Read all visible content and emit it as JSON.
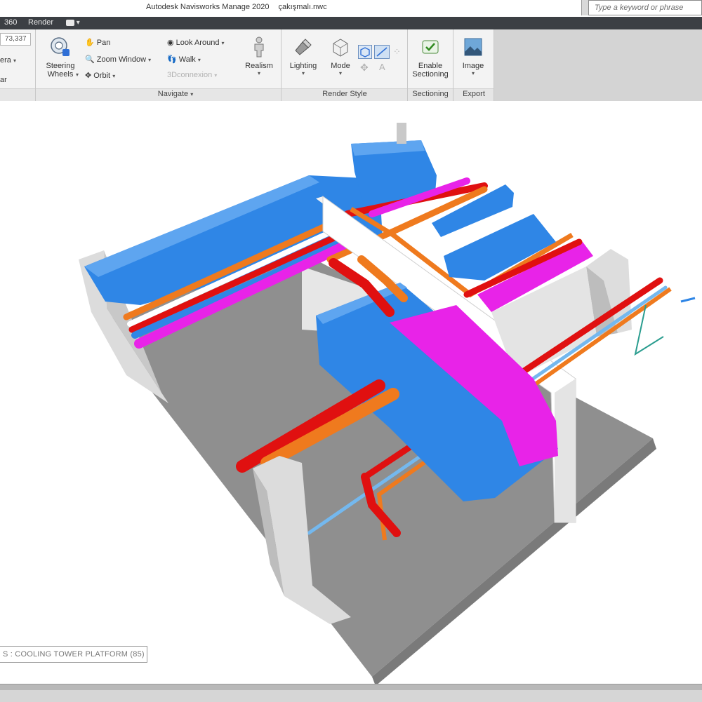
{
  "window": {
    "app_title": "Autodesk Navisworks Manage 2020",
    "file_name": "çakışmalı.nwc"
  },
  "search": {
    "placeholder": "Type a keyword or phrase"
  },
  "tabs": [
    {
      "label": "360"
    },
    {
      "label": "Render"
    }
  ],
  "ribbon": {
    "coordinate_value": "73,337",
    "left_partial_labels": [
      "era",
      "ar"
    ],
    "navigate": {
      "steering_wheels_line1": "Steering",
      "steering_wheels_line2": "Wheels",
      "pan": "Pan",
      "zoom_window": "Zoom Window",
      "orbit": "Orbit",
      "look_around": "Look Around",
      "walk": "Walk",
      "connexion": "3Dconnexion",
      "realism": "Realism",
      "panel_label": "Navigate"
    },
    "render_style": {
      "lighting": "Lighting",
      "mode": "Mode",
      "panel_label": "Render Style"
    },
    "sectioning": {
      "enable_line1": "Enable",
      "enable_line2": "Sectioning",
      "panel_label": "Sectioning"
    },
    "export": {
      "image": "Image",
      "panel_label": "Export"
    }
  },
  "viewport": {
    "status_text": "S : COOLING TOWER PLATFORM (85)"
  },
  "colors": {
    "duct_blue": "#2f86e6",
    "pipe_magenta": "#e823e8",
    "pipe_red": "#e01010",
    "pipe_orange": "#ef7a1e",
    "pipe_light_blue": "#74b8ee",
    "floor_grey": "#8d8d8d",
    "wall_light": "#e2e2e2",
    "ribbon_bg": "#f3f3f3",
    "tabbar_bg": "#3c3f44"
  }
}
